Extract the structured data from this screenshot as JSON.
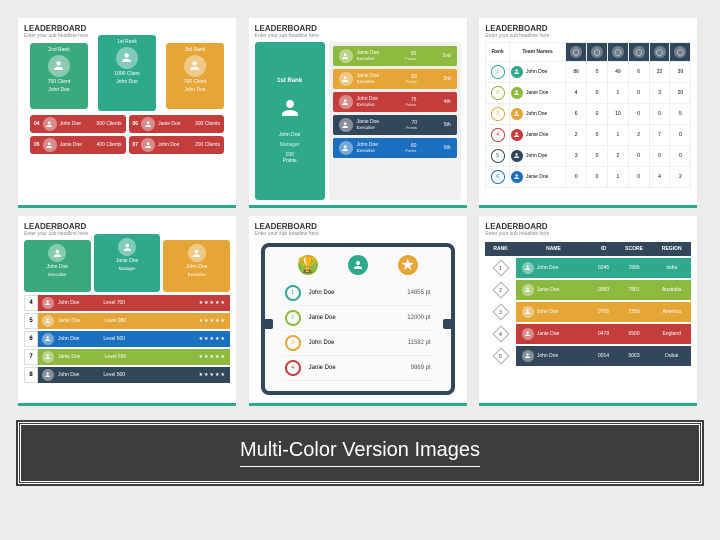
{
  "footer": "Multi-Color Version Images",
  "hdr": "LEADERBOARD",
  "sub": "Enter your sub headline here",
  "p1": {
    "top": [
      {
        "rank": "2nd Rank",
        "stat": "750 Client",
        "cls": "c-green"
      },
      {
        "rank": "1st Rank",
        "stat": "1000 Client",
        "cls": "c-teal"
      },
      {
        "rank": "3rd Rank",
        "stat": "700 Client",
        "cls": "c-orange"
      }
    ],
    "bot": [
      [
        "04",
        "John Doe",
        "500 Clients"
      ],
      [
        "06",
        "Janie Doe",
        "300 Clients"
      ],
      [
        "05",
        "Janie Doe",
        "400 Clients"
      ],
      [
        "07",
        "John Doe",
        "200 Clients"
      ]
    ]
  },
  "p2": {
    "left": {
      "rank": "1st Rank",
      "name": "John Doe",
      "role": "Manager",
      "pts": "100\nPoints"
    },
    "rows": [
      [
        "b-green",
        "Janie Doe",
        "Executive",
        "95",
        "2nd"
      ],
      [
        "b-orange",
        "Janie Doe",
        "Executive",
        "83",
        "3rd"
      ],
      [
        "b-red",
        "John Doe",
        "Executive",
        "75",
        "4th"
      ],
      [
        "b-navy",
        "Janie Doe",
        "Executive",
        "70",
        "5th"
      ],
      [
        "b-blue",
        "John Doe",
        "Executive",
        "60",
        "6th"
      ]
    ]
  },
  "p3": {
    "cols": [
      "Rank",
      "Team Names",
      "",
      "",
      "",
      "",
      "",
      ""
    ],
    "rows": [
      [
        "rk1",
        "b-teal",
        "John Doe",
        "86",
        "0",
        "49",
        "6",
        "22",
        "39"
      ],
      [
        "rk2",
        "b-green",
        "Janie Doe",
        "4",
        "0",
        "1",
        "0",
        "3",
        "20"
      ],
      [
        "rk3",
        "b-orange",
        "John Doe",
        "6",
        "0",
        "10",
        "0",
        "0",
        "5"
      ],
      [
        "rk4",
        "b-red",
        "Janie Doe",
        "2",
        "0",
        "1",
        "2",
        "7",
        "0"
      ],
      [
        "rk5",
        "b-navy",
        "John Doe",
        "3",
        "0",
        "2",
        "0",
        "0",
        "0"
      ],
      [
        "rk6",
        "b-blue",
        "Janie Doe",
        "0",
        "0",
        "1",
        "0",
        "4",
        "2"
      ]
    ]
  },
  "p4": {
    "top": [
      [
        "c-green",
        "John Doe",
        "Executive"
      ],
      [
        "c-teal",
        "Janie Doe",
        "Manager"
      ],
      [
        "c-orange",
        "John Doe",
        "Executive"
      ]
    ],
    "rows": [
      [
        "4",
        "b-red",
        "John Doe",
        "Level 700"
      ],
      [
        "5",
        "b-orange",
        "Janie Doe",
        "Level 980"
      ],
      [
        "6",
        "b-blue",
        "John Doe",
        "Level 600"
      ],
      [
        "7",
        "b-green",
        "Janie Doe",
        "Level 550"
      ],
      [
        "8",
        "b-navy",
        "John Doe",
        "Level 500"
      ]
    ]
  },
  "p5": {
    "rows": [
      [
        "rk1",
        "b-teal",
        "John Doe",
        "14855 pt"
      ],
      [
        "rk2",
        "b-green",
        "Janie Doe",
        "12000 pt"
      ],
      [
        "rk3",
        "b-orange",
        "John Doe",
        "11582 pt"
      ],
      [
        "rk4",
        "b-red",
        "Janie Doe",
        "9869 pt"
      ]
    ]
  },
  "p6": {
    "cols": [
      "RANK",
      "NAME",
      "ID",
      "SCORE",
      "REGION"
    ],
    "rows": [
      [
        "1",
        "r1",
        "John Doe",
        "0245",
        "7895",
        "India"
      ],
      [
        "2",
        "r2",
        "Janie Doe",
        "0983",
        "7801",
        "Australia"
      ],
      [
        "3",
        "r3",
        "John Doe",
        "0765",
        "7350",
        "America"
      ],
      [
        "4",
        "r4",
        "Janie Doe",
        "0478",
        "6500",
        "England"
      ],
      [
        "5",
        "r5",
        "John Doe",
        "0014",
        "5003",
        "Dubai"
      ]
    ]
  }
}
